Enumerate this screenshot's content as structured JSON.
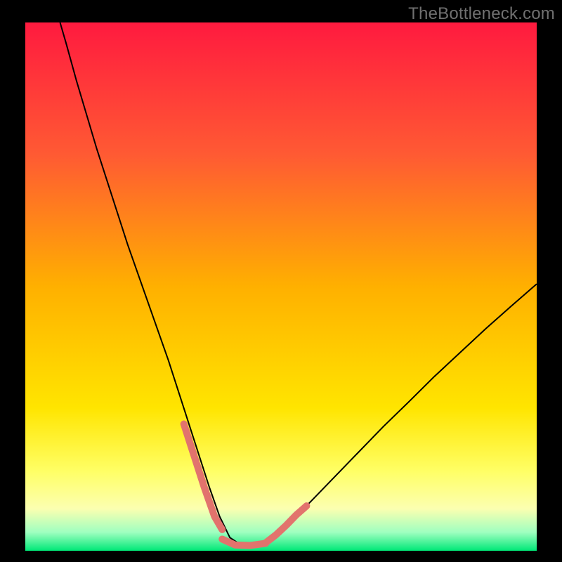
{
  "watermark": "TheBottleneck.com",
  "chart_data": {
    "type": "line",
    "title": "",
    "xlabel": "",
    "ylabel": "",
    "xlim": [
      0,
      100
    ],
    "ylim": [
      0,
      100
    ],
    "grid": false,
    "legend": false,
    "annotations": [],
    "background_gradient": {
      "stops": [
        {
          "offset": 0.0,
          "color": "#ff1a3f"
        },
        {
          "offset": 0.25,
          "color": "#ff5a33"
        },
        {
          "offset": 0.5,
          "color": "#ffb000"
        },
        {
          "offset": 0.73,
          "color": "#ffe500"
        },
        {
          "offset": 0.85,
          "color": "#ffff66"
        },
        {
          "offset": 0.92,
          "color": "#fcffb0"
        },
        {
          "offset": 0.965,
          "color": "#9fffc0"
        },
        {
          "offset": 1.0,
          "color": "#00e877"
        }
      ]
    },
    "series": [
      {
        "name": "bottleneck-curve",
        "stroke": "#000000",
        "stroke_width": 2,
        "x": [
          6.8,
          8,
          10,
          12,
          14,
          16,
          18,
          20,
          22,
          24,
          26,
          28,
          30,
          31,
          32,
          34,
          36,
          38,
          40,
          42,
          43,
          44,
          46,
          48,
          50,
          55,
          60,
          65,
          70,
          75,
          80,
          85,
          90,
          95,
          100
        ],
        "y": [
          100,
          96,
          89,
          82.5,
          76,
          70,
          64,
          58,
          52.5,
          47,
          41.5,
          36,
          30,
          27,
          24,
          18,
          12,
          6.5,
          2.5,
          1.2,
          1.0,
          1.0,
          1.2,
          2.0,
          4.0,
          8.5,
          13.5,
          18.5,
          23.5,
          28.2,
          33.0,
          37.5,
          42.0,
          46.3,
          50.5
        ]
      },
      {
        "name": "accent-left",
        "stroke": "#e2736d",
        "stroke_width": 10,
        "linecap": "round",
        "x": [
          31.0,
          33.0,
          35.0,
          37.0,
          38.5
        ],
        "y": [
          24.0,
          18.0,
          12.0,
          6.5,
          4.0
        ]
      },
      {
        "name": "accent-bottom",
        "stroke": "#e2736d",
        "stroke_width": 10,
        "linecap": "round",
        "x": [
          38.5,
          41.0,
          44.0,
          47.0
        ],
        "y": [
          2.2,
          1.1,
          1.0,
          1.4
        ]
      },
      {
        "name": "accent-right",
        "stroke": "#e2736d",
        "stroke_width": 10,
        "linecap": "round",
        "x": [
          47.0,
          49.0,
          51.0,
          53.0,
          55.0
        ],
        "y": [
          1.5,
          3.0,
          4.8,
          6.8,
          8.5
        ]
      }
    ]
  }
}
